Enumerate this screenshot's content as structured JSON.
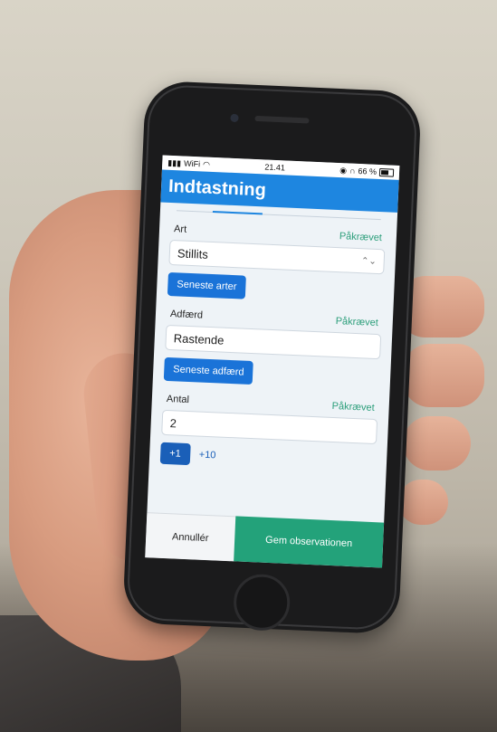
{
  "status_bar": {
    "carrier": "WiFi",
    "time": "21.41",
    "battery": "66 %"
  },
  "app": {
    "title": "Indtastning"
  },
  "form": {
    "species": {
      "label": "Art",
      "required": "Påkrævet",
      "value": "Stillits",
      "recent_button": "Seneste arter"
    },
    "behaviour": {
      "label": "Adfærd",
      "required": "Påkrævet",
      "value": "Rastende",
      "recent_button": "Seneste adfærd"
    },
    "count": {
      "label": "Antal",
      "required": "Påkrævet",
      "value": "2",
      "plus_one": "+1",
      "plus_ten": "+10"
    }
  },
  "footer": {
    "cancel_label": "Annullér",
    "save_label": "Gem observationen"
  },
  "colors": {
    "appbar": "#1e86e0",
    "required": "#2b9e7a",
    "save": "#23a27a"
  }
}
